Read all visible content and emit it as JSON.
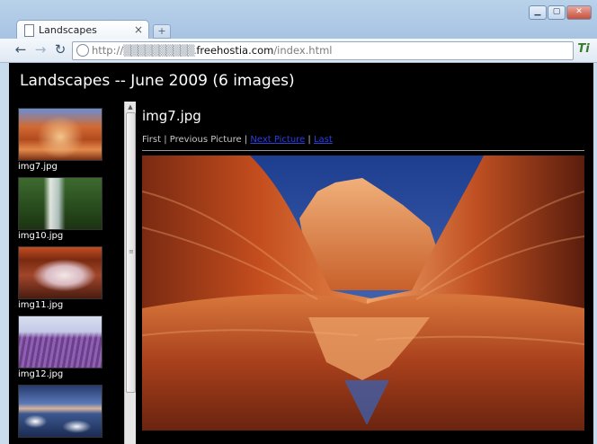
{
  "browser": {
    "tab_title": "Landscapes",
    "tab_close": "×",
    "new_tab": "+",
    "url_protocol": "http://",
    "url_blurred": "▒▒▒▒▒▒▒▒▒▒.",
    "url_domain": "freehostia.com",
    "url_path": "/index.html",
    "back_glyph": "←",
    "forward_glyph": "→",
    "reload_glyph": "↻",
    "menu_glyph": "Ti",
    "min_glyph": "▁",
    "max_glyph": "▢",
    "close_glyph": "✕"
  },
  "gallery": {
    "title": "Landscapes -- June 2009 (6 images)",
    "thumbnails": [
      {
        "label": "img7.jpg",
        "art": "art-wave1"
      },
      {
        "label": "img10.jpg",
        "art": "art-falls"
      },
      {
        "label": "img11.jpg",
        "art": "art-arch"
      },
      {
        "label": "img12.jpg",
        "art": "art-lav"
      },
      {
        "label": "",
        "art": "art-ice"
      }
    ]
  },
  "viewer": {
    "image_title": "img7.jpg",
    "nav": {
      "first": "First",
      "sep": " | ",
      "previous": "Previous Picture",
      "next": "Next Picture",
      "last": "Last"
    }
  },
  "colors": {
    "page_bg": "#000000",
    "link": "#2b3fe0",
    "disabled_link": "#c8c8c8"
  }
}
